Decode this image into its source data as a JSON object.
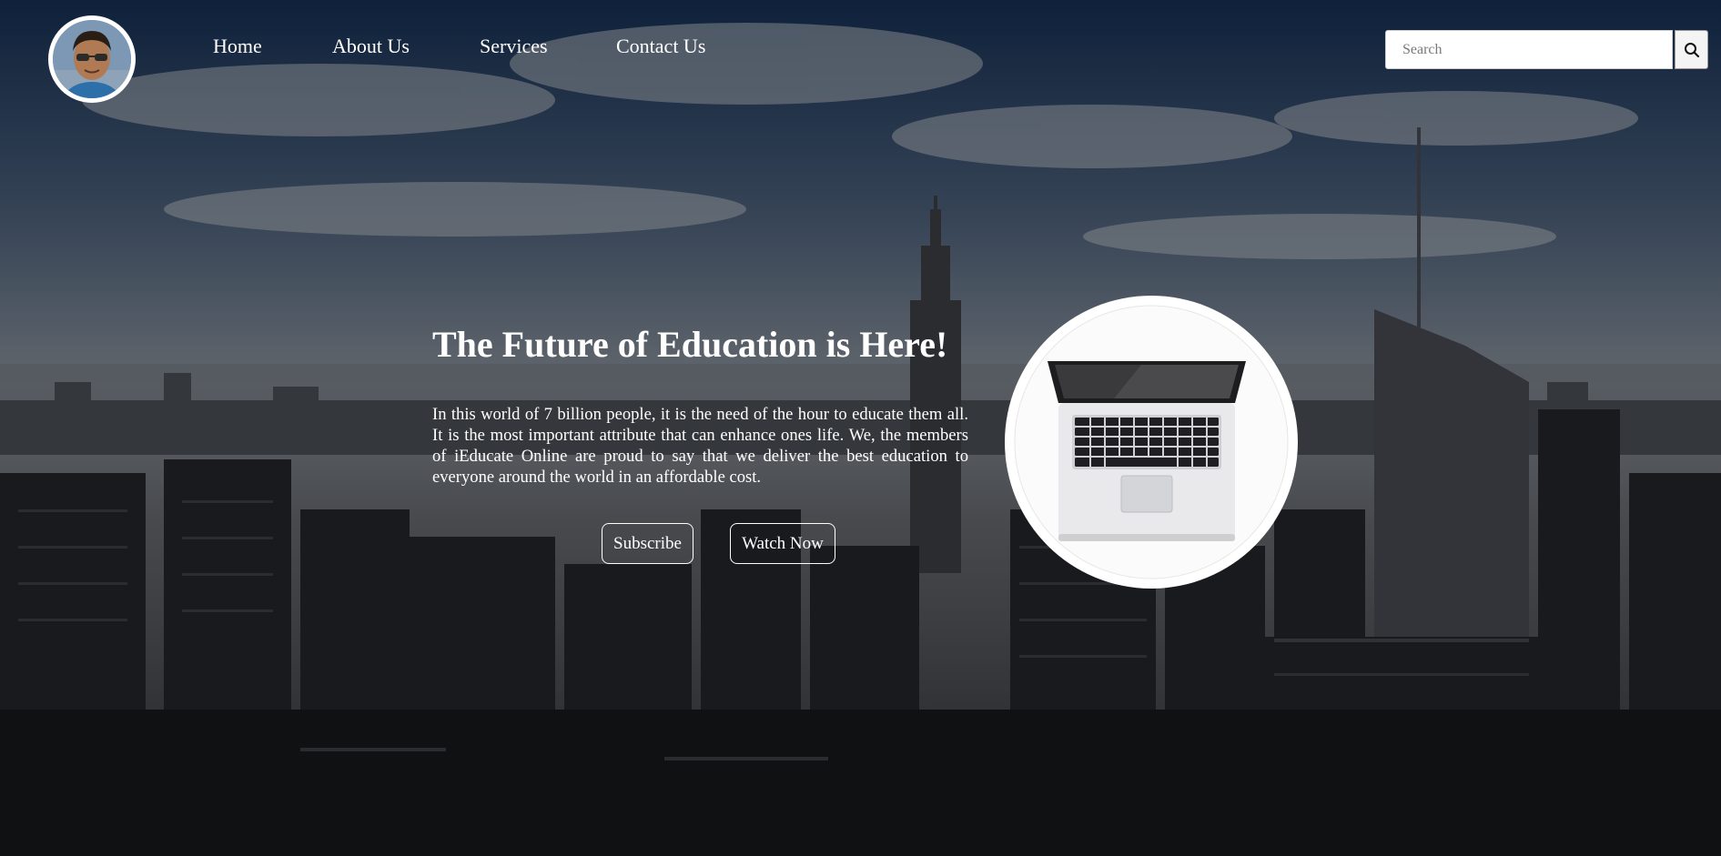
{
  "site": {
    "avatar_alt": "Profile photo"
  },
  "nav": {
    "items": [
      {
        "label": "Home"
      },
      {
        "label": "About Us"
      },
      {
        "label": "Services"
      },
      {
        "label": "Contact Us"
      }
    ]
  },
  "search": {
    "placeholder": "Search",
    "value": "",
    "button_icon": "search-icon"
  },
  "hero": {
    "title": "The Future of Education is Here!",
    "paragraph": "In this world of 7 billion people, it is the need of the hour to educate them all. It is the most important attribute that can enhance ones life. We, the members of iEducate Online are proud to say that we deliver the best education to everyone around the world in an affordable cost.",
    "subscribe_label": "Subscribe",
    "watch_label": "Watch Now",
    "image_icon": "laptop-icon",
    "background_icon": "city-skyline"
  },
  "colors": {
    "text": "#ffffff",
    "overlay": "rgba(0,0,0,0.42)"
  }
}
